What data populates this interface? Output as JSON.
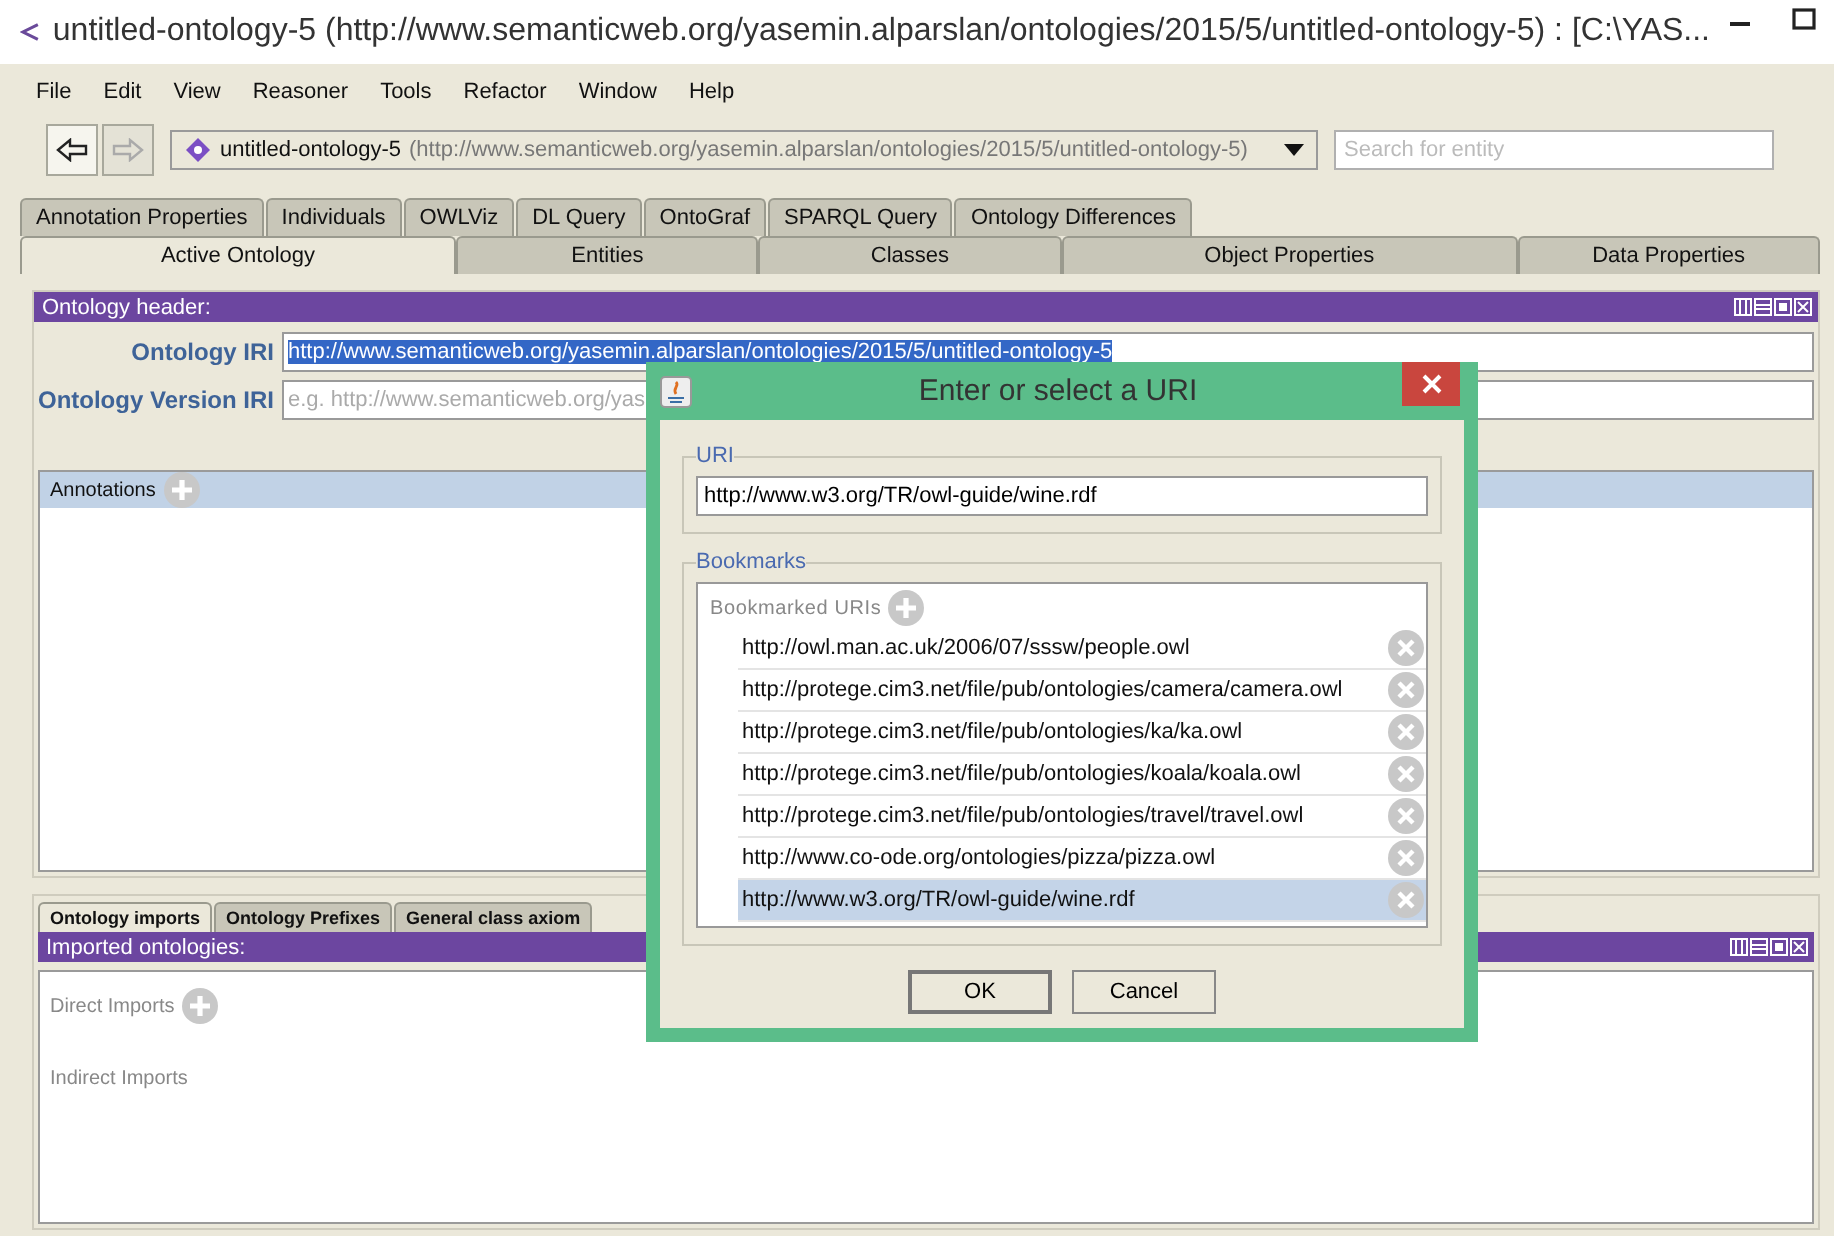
{
  "window": {
    "title": "untitled-ontology-5 (http://www.semanticweb.org/yasemin.alparslan/ontologies/2015/5/untitled-ontology-5)  : [C:\\YAS..."
  },
  "menu": [
    "File",
    "Edit",
    "View",
    "Reasoner",
    "Tools",
    "Refactor",
    "Window",
    "Help"
  ],
  "toolbar": {
    "back_disabled": false,
    "forward_disabled": true,
    "ontology_name": "untitled-ontology-5",
    "ontology_iri": "(http://www.semanticweb.org/yasemin.alparslan/ontologies/2015/5/untitled-ontology-5)",
    "search": {
      "placeholder": "Search for entity"
    }
  },
  "tabs_row_1": [
    {
      "label": "Annotation Properties",
      "selected": false
    },
    {
      "label": "Individuals",
      "selected": false
    },
    {
      "label": "OWLViz",
      "selected": false
    },
    {
      "label": "DL Query",
      "selected": false
    },
    {
      "label": "OntoGraf",
      "selected": false
    },
    {
      "label": "SPARQL Query",
      "selected": false
    },
    {
      "label": "Ontology Differences",
      "selected": false
    }
  ],
  "tabs_row_2": [
    {
      "label": "Active Ontology",
      "selected": true
    },
    {
      "label": "Entities",
      "selected": false
    },
    {
      "label": "Classes",
      "selected": false
    },
    {
      "label": "Object Properties",
      "selected": false
    },
    {
      "label": "Data Properties",
      "selected": false
    }
  ],
  "ontology_header": {
    "title": "Ontology header:",
    "iri_label": "Ontology IRI",
    "iri_value": "http://www.semanticweb.org/yasemin.alparslan/ontologies/2015/5/untitled-ontology-5",
    "version_label": "Ontology Version IRI",
    "version_placeholder": "e.g. http://www.semanticweb.org/yas",
    "annotations_label": "Annotations"
  },
  "bottom_tabs": [
    {
      "label": "Ontology imports",
      "selected": true
    },
    {
      "label": "Ontology Prefixes",
      "selected": false
    },
    {
      "label": "General class axiom",
      "selected": false
    }
  ],
  "imports": {
    "title": "Imported ontologies:",
    "direct": "Direct Imports",
    "indirect": "Indirect Imports"
  },
  "dialog": {
    "title": "Enter or select a URI",
    "uri_legend": "URI",
    "uri_value": "http://www.w3.org/TR/owl-guide/wine.rdf",
    "bookmarks_legend": "Bookmarks",
    "bookmarks_header": "Bookmarked URIs",
    "bookmarks": [
      {
        "uri": "http://owl.man.ac.uk/2006/07/sssw/people.owl",
        "selected": false
      },
      {
        "uri": "http://protege.cim3.net/file/pub/ontologies/camera/camera.owl",
        "selected": false
      },
      {
        "uri": "http://protege.cim3.net/file/pub/ontologies/ka/ka.owl",
        "selected": false
      },
      {
        "uri": "http://protege.cim3.net/file/pub/ontologies/koala/koala.owl",
        "selected": false
      },
      {
        "uri": "http://protege.cim3.net/file/pub/ontologies/travel/travel.owl",
        "selected": false
      },
      {
        "uri": "http://www.co-ode.org/ontologies/pizza/pizza.owl",
        "selected": false
      },
      {
        "uri": "http://www.w3.org/TR/owl-guide/wine.rdf",
        "selected": true
      }
    ],
    "buttons": [
      "OK",
      "Cancel"
    ]
  }
}
